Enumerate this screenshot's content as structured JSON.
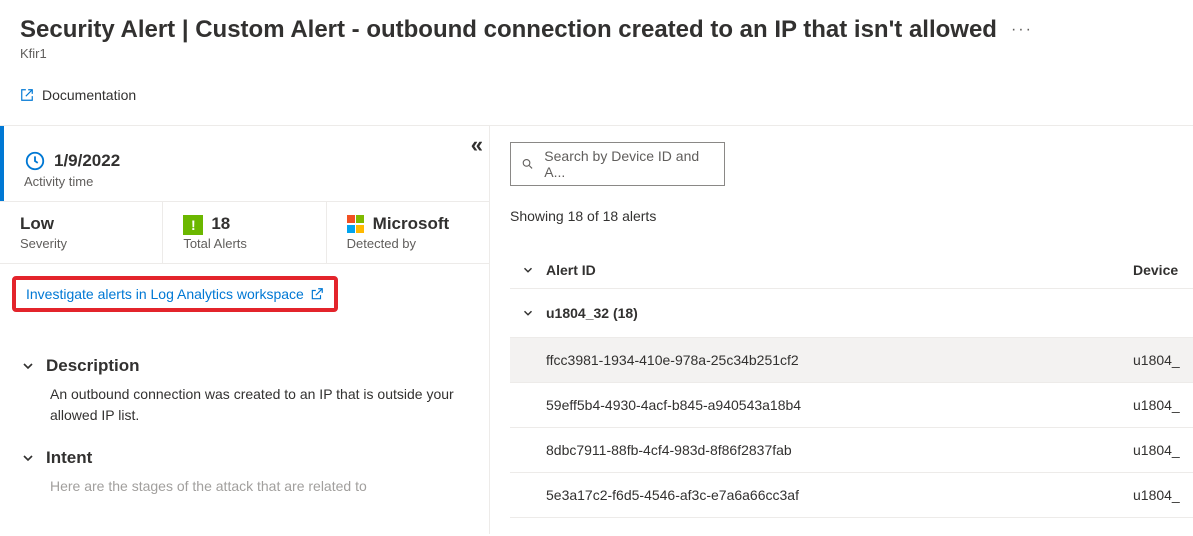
{
  "header": {
    "title": "Security Alert | Custom Alert - outbound connection created to an IP that isn't allowed",
    "subtitle": "Kfir1",
    "documentation_label": "Documentation"
  },
  "left": {
    "activity": {
      "date": "1/9/2022",
      "label": "Activity time"
    },
    "severity": {
      "value": "Low",
      "label": "Severity"
    },
    "total_alerts": {
      "value": "18",
      "label": "Total Alerts"
    },
    "detected_by": {
      "value": "Microsoft",
      "label": "Detected by"
    },
    "investigate_link": "Investigate alerts in Log Analytics workspace",
    "description_heading": "Description",
    "description_body": "An outbound connection was created to an IP that is outside your allowed IP list.",
    "intent_heading": "Intent",
    "intent_body_partial": "Here are the stages of the attack that are related to"
  },
  "right": {
    "search_placeholder": "Search by Device ID and A...",
    "showing": "Showing 18 of 18 alerts",
    "col_alert_id": "Alert ID",
    "col_device": "Device",
    "group": {
      "label": "u1804_32 (18)"
    },
    "rows": [
      {
        "alert_id": "ffcc3981-1934-410e-978a-25c34b251cf2",
        "device": "u1804_",
        "selected": true
      },
      {
        "alert_id": "59eff5b4-4930-4acf-b845-a940543a18b4",
        "device": "u1804_",
        "selected": false
      },
      {
        "alert_id": "8dbc7911-88fb-4cf4-983d-8f86f2837fab",
        "device": "u1804_",
        "selected": false
      },
      {
        "alert_id": "5e3a17c2-f6d5-4546-af3c-e7a6a66cc3af",
        "device": "u1804_",
        "selected": false
      }
    ]
  }
}
